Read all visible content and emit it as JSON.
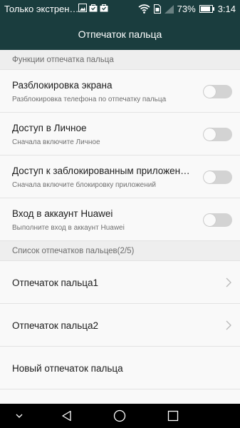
{
  "status_bar": {
    "carrier": "Только экстрен…",
    "notification_icons": [
      "image-icon",
      "bag-icon",
      "bag-icon"
    ],
    "battery": "73%",
    "time": "3:14"
  },
  "header": {
    "title": "Отпечаток пальца"
  },
  "sections": {
    "functions": {
      "title": "Функции отпечатка пальца",
      "items": [
        {
          "title": "Разблокировка экрана",
          "subtitle": "Разблокировка телефона по отпечатку пальца",
          "enabled": false
        },
        {
          "title": "Доступ в Личное",
          "subtitle": "Сначала включите Личное",
          "enabled": false
        },
        {
          "title": "Доступ к заблокированным приложениям",
          "subtitle": "Сначала включите блокировку приложений",
          "enabled": false
        },
        {
          "title": "Вход в аккаунт Huawei",
          "subtitle": "Выполните вход в аккаунт Huawei",
          "enabled": false
        }
      ]
    },
    "list": {
      "title": "Список отпечатков пальцев(2/5)",
      "items": [
        {
          "title": "Отпечаток пальца1"
        },
        {
          "title": "Отпечаток пальца2"
        },
        {
          "title": "Новый отпечаток пальца"
        }
      ]
    }
  },
  "colors": {
    "header_bg": "#1a3d3e",
    "toggle_off": "#d3d3d3",
    "section_bg": "#eeeeee"
  }
}
